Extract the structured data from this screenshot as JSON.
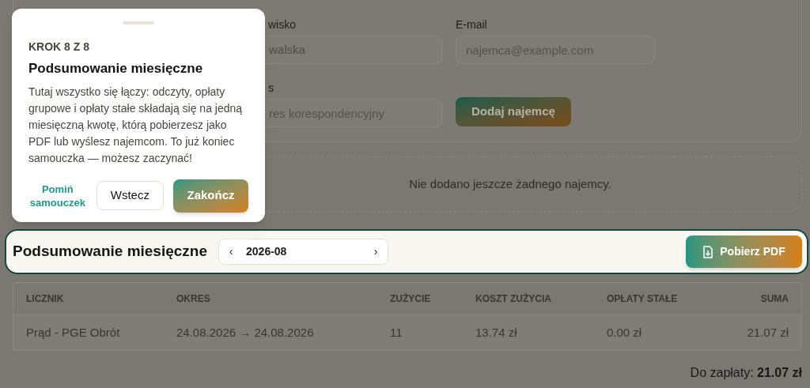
{
  "form": {
    "fields": [
      {
        "label": "wisko",
        "value": "walska"
      },
      {
        "label": "E-mail",
        "placeholder": "najemca@example.com"
      },
      {
        "label": "s",
        "placeholder": "res korespondencyjny"
      }
    ],
    "add_button": "Dodaj najemcę"
  },
  "empty_state": "Nie dodano jeszcze żadnego najemcy.",
  "summary": {
    "title": "Podsumowanie miesięczne",
    "prev": "‹",
    "month": "2026-08",
    "next": "›",
    "pdf_button": "Pobierz PDF"
  },
  "table": {
    "columns": [
      "LICZNIK",
      "OKRES",
      "ZUŻYCIE",
      "KOSZT ZUŻYCIA",
      "OPŁATY STAŁE",
      "SUMA"
    ],
    "rows": [
      [
        "Prąd - PGE Obrót",
        "24.08.2026 → 24.08.2026",
        "11",
        "13.74 zł",
        "0.00 zł",
        "21.07 zł"
      ]
    ]
  },
  "total": "Do zapłaty: **21.07 zł**",
  "tour": {
    "step": "KROK 8 Z 8",
    "title": "Podsumowanie miesięczne",
    "body": "Tutaj wszystko się łączy: odczyty, opłaty grupowe i opłaty stałe składają się na jedną miesięczną kwotę, którą pobierzesz jako PDF lub wyślesz najemcom. To już koniec samouczka — możesz zaczynać!",
    "skip": "Pomiń samouczek",
    "back": "Wstecz",
    "finish": "Zakończ"
  }
}
